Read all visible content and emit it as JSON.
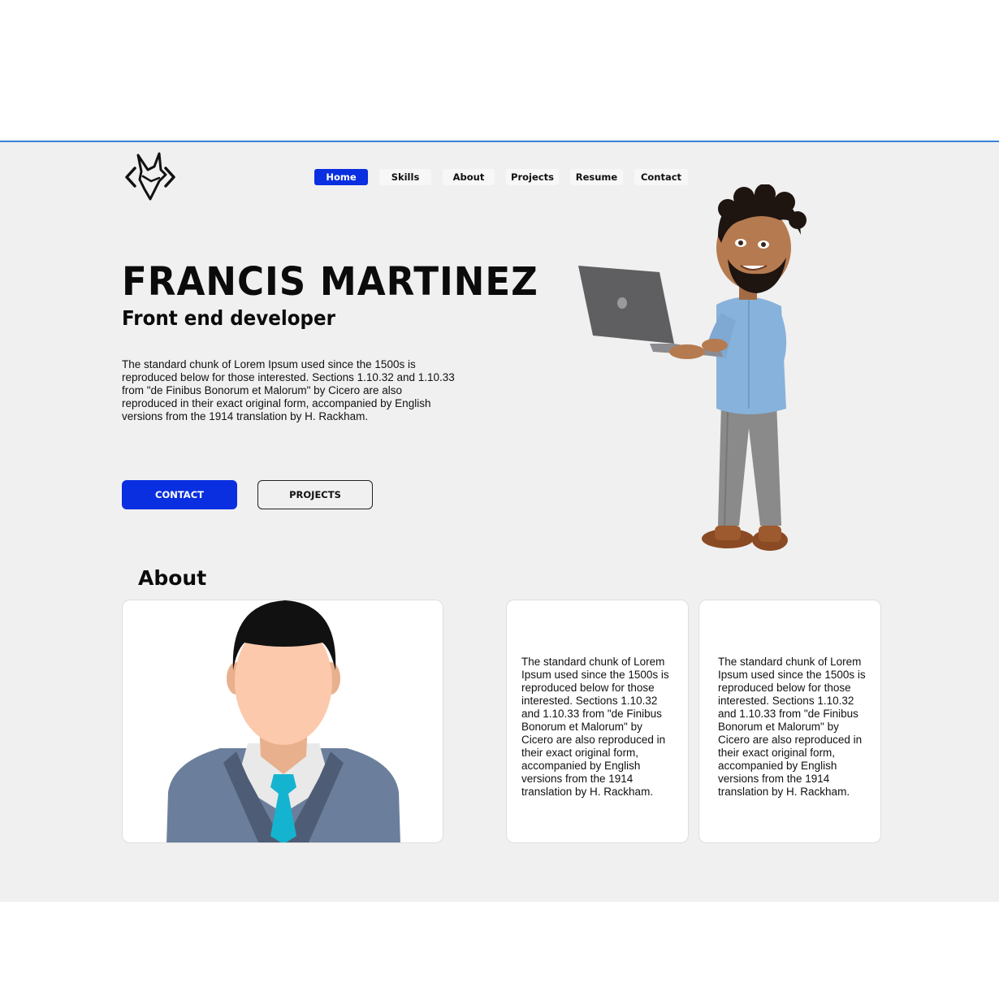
{
  "nav": {
    "items": [
      {
        "label": "Home",
        "active": true
      },
      {
        "label": "Skills",
        "active": false
      },
      {
        "label": "About",
        "active": false
      },
      {
        "label": "Projects",
        "active": false
      },
      {
        "label": "Resume",
        "active": false
      },
      {
        "label": "Contact",
        "active": false
      }
    ]
  },
  "hero": {
    "name": "FRANCIS MARTINEZ",
    "role": "Front end developer",
    "description": "The standard chunk of Lorem Ipsum used since the 1500s is reproduced below for those interested. Sections 1.10.32 and 1.10.33 from \"de Finibus Bonorum et Malorum\" by Cicero are also reproduced in their exact original form, accompanied by English versions from the 1914 translation by H. Rackham.",
    "contact_button": "CONTACT",
    "projects_button": "PROJECTS"
  },
  "about": {
    "title": "About",
    "card_1_text": "The standard chunk of Lorem Ipsum used since the 1500s is reproduced below for those interested. Sections 1.10.32 and 1.10.33 from \"de Finibus Bonorum et Malorum\" by Cicero are also reproduced in their exact original form, accompanied by English versions from the 1914 translation by H. Rackham.",
    "card_2_text": "The standard chunk of Lorem Ipsum used since the 1500s is reproduced below for those interested. Sections 1.10.32 and 1.10.33 from \"de Finibus Bonorum et Malorum\" by Cicero are also reproduced in their exact original form, accompanied by English versions from the 1914 translation by H. Rackham."
  },
  "colors": {
    "accent": "#0a2fe0",
    "page_background": "#f0f0f0",
    "top_border": "#3b82d6"
  },
  "icons": {
    "logo": "fox-code-logo",
    "hero_image": "developer-with-laptop-illustration",
    "about_image": "businessman-avatar-illustration"
  }
}
